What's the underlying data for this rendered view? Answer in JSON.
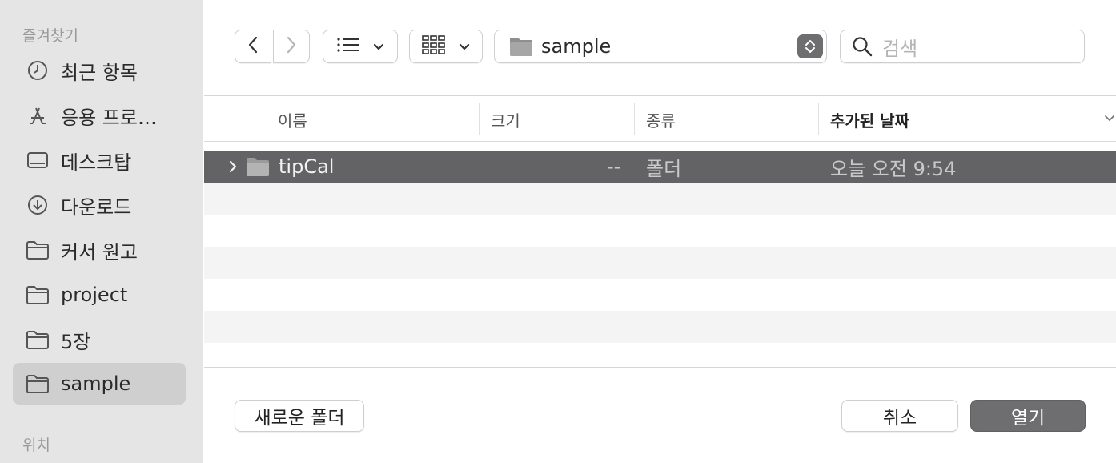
{
  "sidebar": {
    "favorites_title": "즐겨찾기",
    "items": [
      {
        "label": "최근 항목",
        "icon": "clock-icon"
      },
      {
        "label": "응용 프로…",
        "icon": "applications-icon"
      },
      {
        "label": "데스크탑",
        "icon": "desktop-icon"
      },
      {
        "label": "다운로드",
        "icon": "download-icon"
      },
      {
        "label": "커서 원고",
        "icon": "folder-icon"
      },
      {
        "label": "project",
        "icon": "folder-icon"
      },
      {
        "label": "5장",
        "icon": "folder-icon"
      },
      {
        "label": "sample",
        "icon": "folder-icon",
        "selected": true
      }
    ],
    "locations_title": "위치"
  },
  "toolbar": {
    "path": "sample",
    "search_placeholder": "검색"
  },
  "columns": {
    "name": "이름",
    "size": "크기",
    "kind": "종류",
    "date_added": "추가된 날짜"
  },
  "files": [
    {
      "name": "tipCal",
      "size": "--",
      "kind": "폴더",
      "date_added": "오늘 오전 9:54",
      "selected": true
    }
  ],
  "buttons": {
    "new_folder": "새로운 폴더",
    "cancel": "취소",
    "open": "열기"
  },
  "colors": {
    "selection": "#636366",
    "primary_button": "#6e6e70",
    "sidebar_bg": "#e6e5e5"
  }
}
